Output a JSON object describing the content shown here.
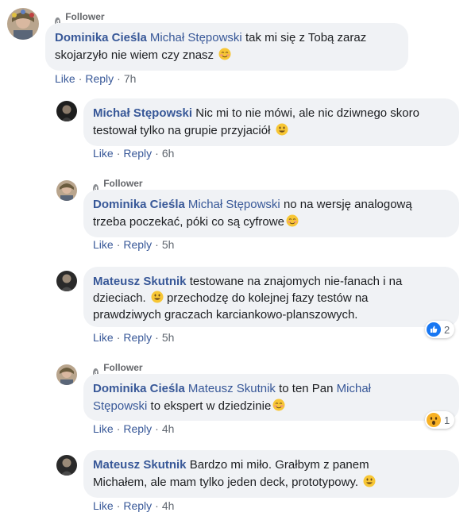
{
  "badge_label": "Follower anniversary",
  "badge_glyph": "4",
  "actions": {
    "like": "Like",
    "reply": "Reply",
    "sep": "·"
  },
  "emoji_names": [
    "smiling-blush-emoji",
    "grinning-emoji"
  ],
  "reaction_icons": [
    "like-reaction-icon",
    "wow-reaction-icon"
  ],
  "colors": {
    "link": "#385898",
    "bubble": "#f0f2f5",
    "meta": "#606770",
    "like_blue": "#1877f2",
    "wow_yellow": "#f7b125"
  },
  "comments": [
    {
      "author": "Dominika Cieśla",
      "badge": true,
      "mention": "Michał Stępowski",
      "text_a": " tak mi się z Tobą zaraz",
      "text_b": "skojarzyło nie wiem czy znasz ",
      "time": "7h"
    },
    {
      "author": "Michał Stępowski",
      "badge": false,
      "text_a": " Nic mi to nie mówi, ale nic dziwnego skoro",
      "text_b": "testował tylko na grupie przyjaciół ",
      "time": "6h"
    },
    {
      "author": "Dominika Cieśla",
      "badge": true,
      "mention": "Michał Stępowski",
      "text_a": " no na wersję analogową",
      "text_b": "trzeba poczekać, póki co są cyfrowe",
      "time": "5h"
    },
    {
      "author": "Mateusz Skutnik",
      "badge": false,
      "text_a": " testowane na znajomych nie-fanach i na",
      "text_b": "dzieciach. ",
      "text_c": " przechodzę do kolejnej fazy testów na",
      "text_d": "prawdziwych graczach karciankowo-planszowych.",
      "time": "5h",
      "reaction_count": "2"
    },
    {
      "author": "Dominika Cieśla",
      "badge": true,
      "mention": "Mateusz Skutnik",
      "text_a": " to ten Pan ",
      "mention2_a": "Michał",
      "mention2_b": "Stępowski",
      "text_b": " to ekspert w dziedzinie",
      "time": "4h",
      "reaction_count": "1"
    },
    {
      "author": "Mateusz Skutnik",
      "badge": false,
      "text_a": " Bardzo mi miło. Grałbym z panem",
      "text_b": "Michałem, ale mam tylko jeden deck, prototypowy. ",
      "time": "4h"
    }
  ]
}
